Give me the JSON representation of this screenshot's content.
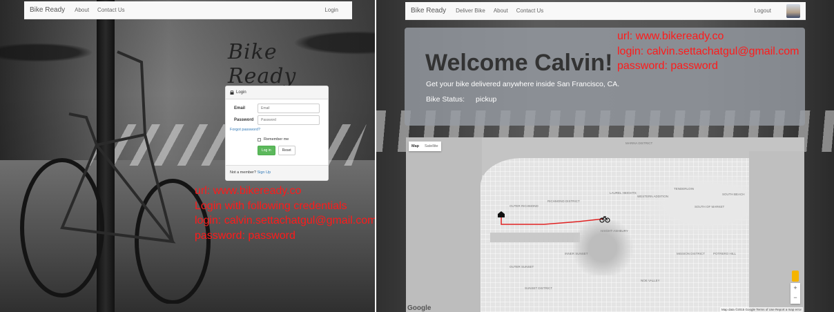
{
  "left": {
    "navbar": {
      "brand": "Bike Ready",
      "links": [
        "About",
        "Contact Us"
      ],
      "login": "Login"
    },
    "logo": "Bike Ready",
    "login_panel": {
      "heading": "Login",
      "email_label": "Email",
      "email_placeholder": "Email",
      "password_label": "Password",
      "password_placeholder": "Password",
      "forgot": "Forgot password?",
      "remember": "Remember me",
      "login_button": "Log in",
      "reset_button": "Reset",
      "footer_text": "Not a member?",
      "signup": "Sign Up"
    },
    "note": [
      "url: www.bikeready.co",
      "Login with following credentials",
      "login: calvin.settachatgul@gmail.com",
      "password: password"
    ]
  },
  "right": {
    "navbar": {
      "brand": "Bike Ready",
      "links": [
        "Deliver Bike",
        "About",
        "Contact Us"
      ],
      "logout": "Logout"
    },
    "welcome": "Welcome Calvin!",
    "subtitle": "Get your bike delivered anywhere inside San Francisco, CA.",
    "status_label": "Bike Status:",
    "status_value": "pickup",
    "note": [
      "url: www.bikeready.co",
      "login: calvin.settachatgul@gmail.com",
      "password: password"
    ],
    "map": {
      "type_map": "Map",
      "type_satellite": "Satellite",
      "attribution": "Map data ©2015 Google   Terms of Use   Report a map error",
      "logo": "Google",
      "labels": [
        "MARINA DISTRICT",
        "RICHMOND DISTRICT",
        "OUTER RICHMOND",
        "INNER SUNSET",
        "OUTER SUNSET",
        "SUNSET DISTRICT",
        "MISSION DISTRICT",
        "SOUTH OF MARKET",
        "LAUREL HEIGHTS",
        "WESTERN ADDITION",
        "NOE VALLEY",
        "TENDERLOIN",
        "HAIGHT-ASHBURY",
        "SOUTH BEACH",
        "POTRERO HILL"
      ],
      "route_color": "#e02020"
    }
  }
}
